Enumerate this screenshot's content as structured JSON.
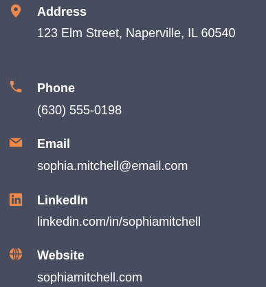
{
  "accent_color": "#f0884a",
  "background_color": "#474d5e",
  "contacts": [
    {
      "icon": "location-pin-icon",
      "label": "Address",
      "value": "123 Elm Street, Naperville, IL 60540"
    },
    {
      "icon": "phone-icon",
      "label": "Phone",
      "value": "(630) 555-0198"
    },
    {
      "icon": "envelope-icon",
      "label": "Email",
      "value": "sophia.mitchell@email.com"
    },
    {
      "icon": "linkedin-icon",
      "label": "LinkedIn",
      "value": "linkedin.com/in/sophiamitchell"
    },
    {
      "icon": "globe-icon",
      "label": "Website",
      "value": "sophiamitchell.com"
    }
  ]
}
